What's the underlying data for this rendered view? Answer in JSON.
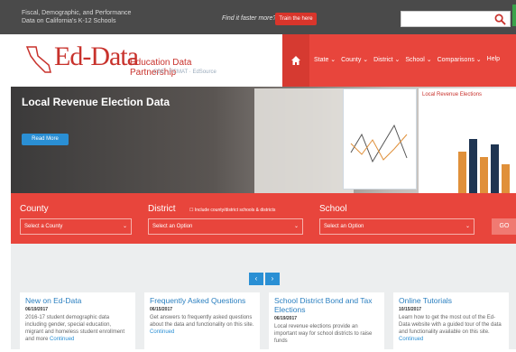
{
  "topbar": {
    "tagline": "Fiscal, Demographic, and Performance Data on California's K-12 Schools",
    "find_text": "Find it faster more?",
    "train_label": "Train the here"
  },
  "search": {
    "placeholder": ""
  },
  "logo": {
    "name": "Ed-Data",
    "subtitle": "Education Data Partnership",
    "tagline": "CDE · FCMAT · EdSource"
  },
  "nav": {
    "items": [
      "State",
      "County",
      "District",
      "School",
      "Comparisons",
      "Help"
    ]
  },
  "hero": {
    "title": "Local Revenue Election Data",
    "read_more": "Read More",
    "panel_title": "Local Revenue Elections"
  },
  "selectors": {
    "county_label": "County",
    "county_placeholder": "Select a County",
    "district_label": "District",
    "district_check": "Include county/district schools & districts",
    "district_placeholder": "Select an Option",
    "school_label": "School",
    "school_placeholder": "Select an Option",
    "go_label": "GO"
  },
  "pager": {
    "prev": "‹",
    "next": "›"
  },
  "cards": [
    {
      "title": "New on Ed-Data",
      "date": "06/19/2017",
      "body": "2016-17 student demographic data including gender, special education, migrant and homeless student enrollment and more",
      "link": "Continued"
    },
    {
      "title": "Frequently Asked Questions",
      "date": "06/15/2017",
      "body": "Get answers to frequently asked questions about the data and functionality on this site.",
      "link": "Continued"
    },
    {
      "title": "School District Bond and Tax Elections",
      "date": "06/19/2017",
      "body": "Local revenue elections provide an important way for school districts to raise funds",
      "link": ""
    },
    {
      "title": "Online Tutorials",
      "date": "10/15/2017",
      "body": "Learn how to get the most out of the Ed-Data website with a guided tour of the data and functionality available on this site.",
      "link": "Continued"
    }
  ],
  "colors": {
    "brand_red": "#e8453c",
    "link_blue": "#2a8fd4",
    "topbar": "#4a4a4a"
  }
}
